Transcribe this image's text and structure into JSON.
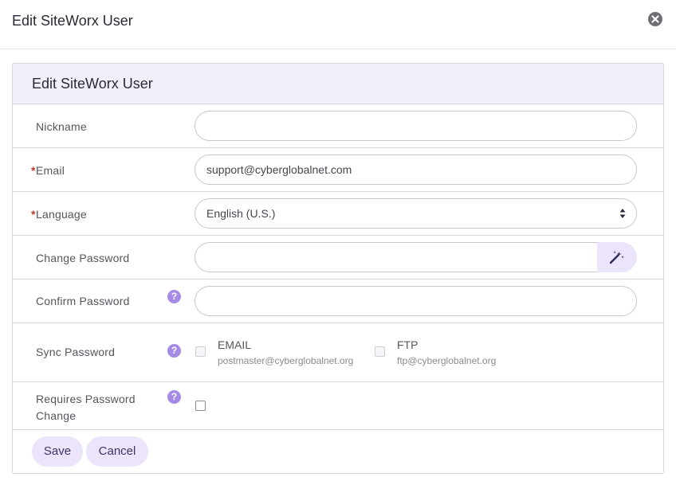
{
  "modal": {
    "title": "Edit SiteWorx User"
  },
  "panel": {
    "title": "Edit SiteWorx User"
  },
  "form": {
    "nickname": {
      "label": "Nickname",
      "value": ""
    },
    "email": {
      "required_mark": "*",
      "label": "Email",
      "value": "support@cyberglobalnet.com"
    },
    "language": {
      "required_mark": "*",
      "label": "Language",
      "selected": "English (U.S.)"
    },
    "change_password": {
      "label": "Change Password",
      "value": ""
    },
    "confirm_password": {
      "label": "Confirm Password",
      "value": "",
      "help": "?"
    },
    "sync_password": {
      "label": "Sync Password",
      "help": "?",
      "options": [
        {
          "title": "EMAIL",
          "subtitle": "postmaster@cyberglobalnet.org"
        },
        {
          "title": "FTP",
          "subtitle": "ftp@cyberglobalnet.org"
        }
      ]
    },
    "requires_password_change": {
      "label_line1": "Requires Password",
      "label_line2": "Change",
      "help": "?"
    }
  },
  "buttons": {
    "save": "Save",
    "cancel": "Cancel"
  },
  "colors": {
    "accent": "#a58be6",
    "button_bg": "#ece4fb",
    "header_bg": "#f3eff8",
    "required": "#c0392b"
  },
  "icons": {
    "close": "close-circle-icon",
    "generate": "magic-wand-icon",
    "help": "question-circle-icon",
    "select": "sort-arrows-icon"
  }
}
